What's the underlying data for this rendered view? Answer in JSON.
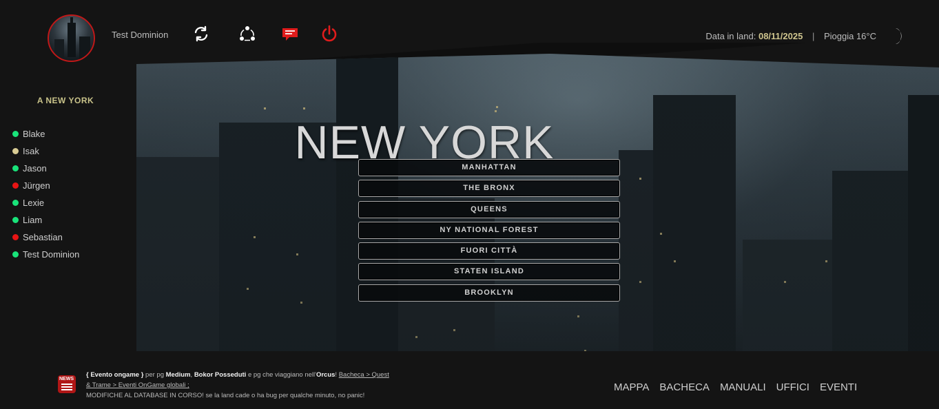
{
  "header": {
    "username": "Test Dominion",
    "icons": [
      "refresh-icon",
      "share-icon",
      "messages-icon",
      "power-icon"
    ],
    "date_label": "Data in land:",
    "date_value": "08/11/2025",
    "separator": "|",
    "weather": "Pioggia 16°C"
  },
  "sidebar": {
    "title": "A NEW YORK",
    "users": [
      {
        "name": "Blake",
        "status_color": "#19e37a"
      },
      {
        "name": "Isak",
        "status_color": "#d9cc94"
      },
      {
        "name": "Jason",
        "status_color": "#19e37a"
      },
      {
        "name": "Jürgen",
        "status_color": "#e81414"
      },
      {
        "name": "Lexie",
        "status_color": "#19e37a"
      },
      {
        "name": "Liam",
        "status_color": "#19e37a"
      },
      {
        "name": "Sebastian",
        "status_color": "#e81414"
      },
      {
        "name": "Test Dominion",
        "status_color": "#19e37a"
      }
    ]
  },
  "main": {
    "title": "NEW YORK",
    "districts": [
      "MANHATTAN",
      "THE BRONX",
      "QUEENS",
      "NY NATIONAL FOREST",
      "FUORI CITTÀ",
      "STATEN ISLAND",
      "BROOKLYN"
    ]
  },
  "footer": {
    "news": {
      "event_tag": "{ Evento ongame }",
      "t1": " per pg ",
      "medium": "Medium",
      "comma": ", ",
      "bokor": "Bokor Posseduti",
      "t2": " e pg che viaggiano nell'",
      "orcus": "Orcus",
      "t3": "! ",
      "link": "Bacheca > Quest & Trame > Eventi OnGame globali ;",
      "line2": "MODIFICHE AL DATABASE IN CORSO! se la land cade o ha bug per qualche minuto, no panic!"
    },
    "nav": [
      "MAPPA",
      "BACHECA",
      "MANUALI",
      "UFFICI",
      "EVENTI"
    ]
  },
  "colors": {
    "accent_red": "#d41c1c",
    "online_green": "#19e37a",
    "date_gold": "#cfc58e"
  }
}
